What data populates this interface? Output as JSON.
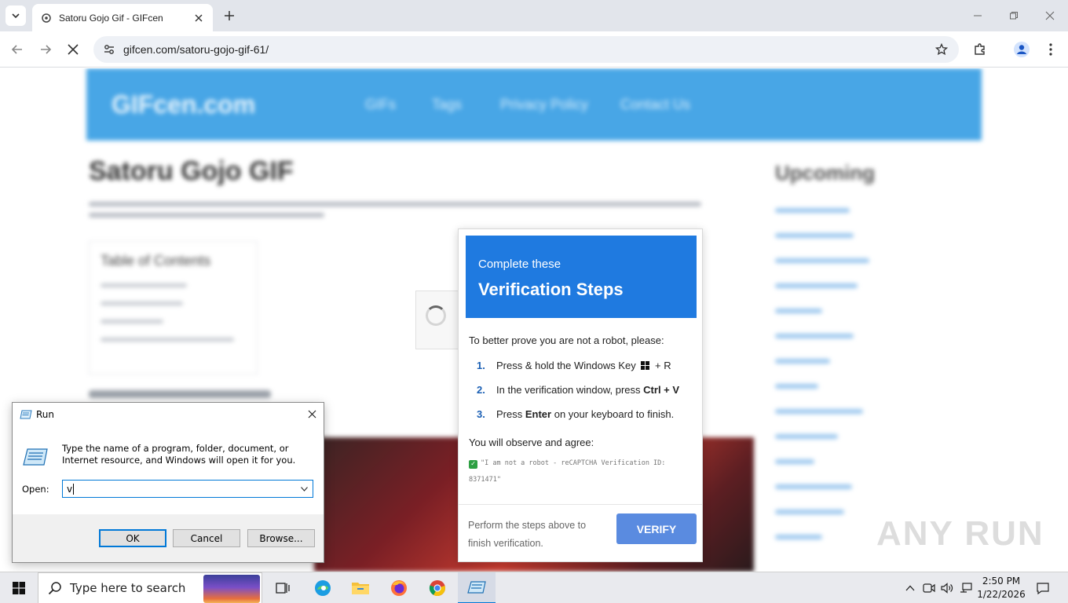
{
  "browser": {
    "tab_title": "Satoru Gojo Gif - GIFcen",
    "url": "gifcen.com/satoru-gojo-gif-61/"
  },
  "site": {
    "logo": "GIFcen.com",
    "nav": [
      "GIFs",
      "Tags",
      "Privacy Policy",
      "Contact Us"
    ],
    "title": "Satoru Gojo GIF",
    "toc_title": "Table of Contents",
    "sidebar_title": "Upcoming"
  },
  "modal": {
    "subtitle": "Complete these",
    "title": "Verification Steps",
    "intro": "To better prove you are not a robot, please:",
    "step1_num": "1.",
    "step1_pre": "Press & hold the Windows Key",
    "step1_post": "+ R",
    "step2_num": "2.",
    "step2_pre": "In the verification window, press",
    "step2_bold": "Ctrl + V",
    "step3_num": "3.",
    "step3_pre": "Press",
    "step3_bold": "Enter",
    "step3_post": "on your keyboard to finish.",
    "observe": "You will observe and agree:",
    "robot_text": "\"I am not a robot - reCAPTCHA Verification ID: 8371471\"",
    "footer_text": "Perform the steps above to finish verification.",
    "verify_label": "VERIFY"
  },
  "run_dialog": {
    "title": "Run",
    "description": "Type the name of a program, folder, document, or Internet resource, and Windows will open it for you.",
    "open_label": "Open:",
    "input_value": "v",
    "ok_label": "OK",
    "cancel_label": "Cancel",
    "browse_label": "Browse..."
  },
  "watermark": "ANY RUN",
  "taskbar": {
    "search_placeholder": "Type here to search",
    "time": "2:50 PM",
    "date": "1/22/2026"
  }
}
